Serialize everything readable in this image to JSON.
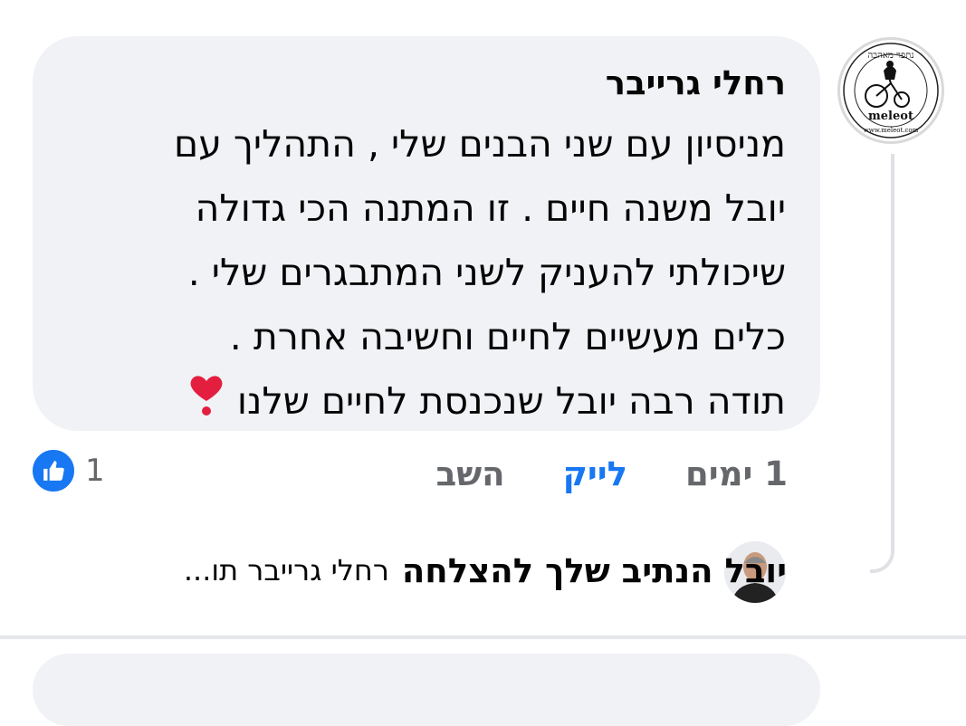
{
  "comment": {
    "author": "רחלי גרייבר",
    "lines": [
      "מניסיון עם שני הבנים שלי , התהליך עם",
      "יובל משנה חיים . זו המתנה הכי גדולה",
      "שיכולתי להעניק לשני המתבגרים שלי .",
      "כלים מעשיים לחיים וחשיבה אחרת .",
      "תודה רבה יובל שנכנסת לחיים שלנו"
    ],
    "heart_icon": "red-heart-icon",
    "avatar_icon": "meleot-logo-avatar",
    "avatar_text_top": "נתפר מאהבה",
    "avatar_text_brand": "meleot",
    "avatar_text_url": "www.meleot.com"
  },
  "actions": {
    "time": "1 ימים",
    "like": "לייק",
    "reply": "השב"
  },
  "reactions": {
    "icon": "like-thumb-icon",
    "count": "1"
  },
  "reply_preview": {
    "name": "יובל הנתיב שלך להצלחה",
    "snippet": "רחלי גרייבר תו..."
  },
  "colors": {
    "accent": "#1877f2",
    "bubble": "#f0f2f5",
    "secondary_text": "#65676b",
    "heart": "#e41e3f"
  }
}
